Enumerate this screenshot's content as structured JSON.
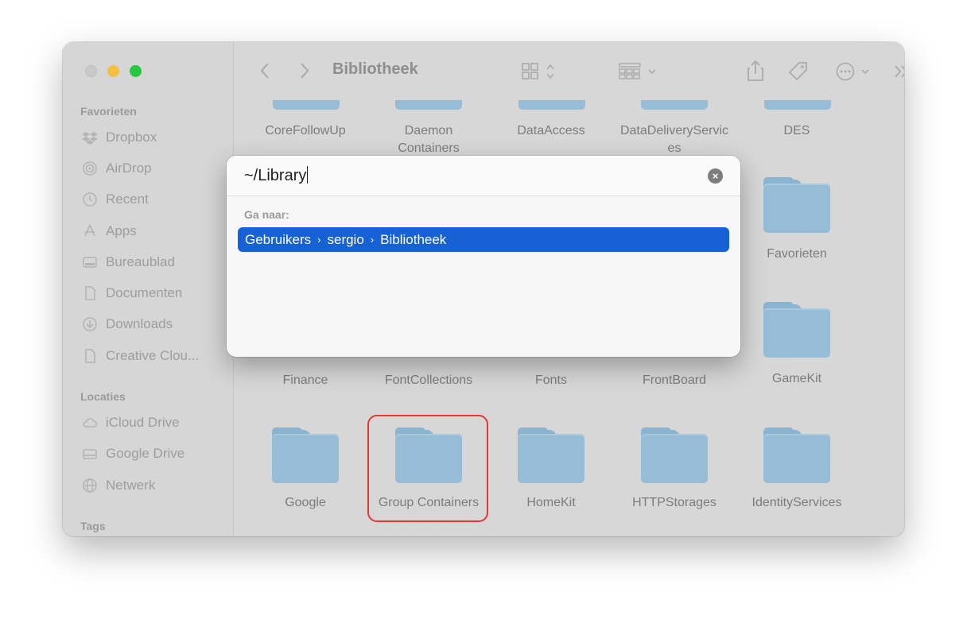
{
  "window": {
    "title": "Bibliotheek"
  },
  "sidebar": {
    "sections": [
      {
        "title": "Favorieten",
        "items": [
          {
            "label": "Dropbox",
            "icon": "dropbox-icon"
          },
          {
            "label": "AirDrop",
            "icon": "airdrop-icon"
          },
          {
            "label": "Recent",
            "icon": "clock-icon"
          },
          {
            "label": "Apps",
            "icon": "apps-icon"
          },
          {
            "label": "Bureaublad",
            "icon": "desktop-icon"
          },
          {
            "label": "Documenten",
            "icon": "document-icon"
          },
          {
            "label": "Downloads",
            "icon": "download-icon"
          },
          {
            "label": "Creative Clou...",
            "icon": "file-icon"
          }
        ]
      },
      {
        "title": "Locaties",
        "items": [
          {
            "label": "iCloud Drive",
            "icon": "cloud-icon"
          },
          {
            "label": "Google Drive",
            "icon": "drive-icon"
          },
          {
            "label": "Netwerk",
            "icon": "globe-icon"
          }
        ]
      },
      {
        "title": "Tags",
        "items": []
      }
    ]
  },
  "folders": [
    {
      "label": "CoreFollowUp"
    },
    {
      "label": "Daemon Containers"
    },
    {
      "label": "DataAccess"
    },
    {
      "label": "DataDeliveryServices"
    },
    {
      "label": "DES"
    },
    {
      "label": "Favorieten"
    },
    {
      "label": "Finance"
    },
    {
      "label": "FontCollections"
    },
    {
      "label": "Fonts"
    },
    {
      "label": "FrontBoard"
    },
    {
      "label": "GameKit"
    },
    {
      "label": "Google"
    },
    {
      "label": "Group Containers"
    },
    {
      "label": "HomeKit"
    },
    {
      "label": "HTTPStorages"
    },
    {
      "label": "IdentityServices"
    }
  ],
  "goto_dialog": {
    "input_value": "~/Library",
    "section_label": "Ga naar:",
    "suggestion": [
      "Gebruikers",
      "sergio",
      "Bibliotheek"
    ]
  },
  "colors": {
    "accent": "#1662d4",
    "highlight": "#e7382d",
    "folder": "#97bcd6"
  }
}
